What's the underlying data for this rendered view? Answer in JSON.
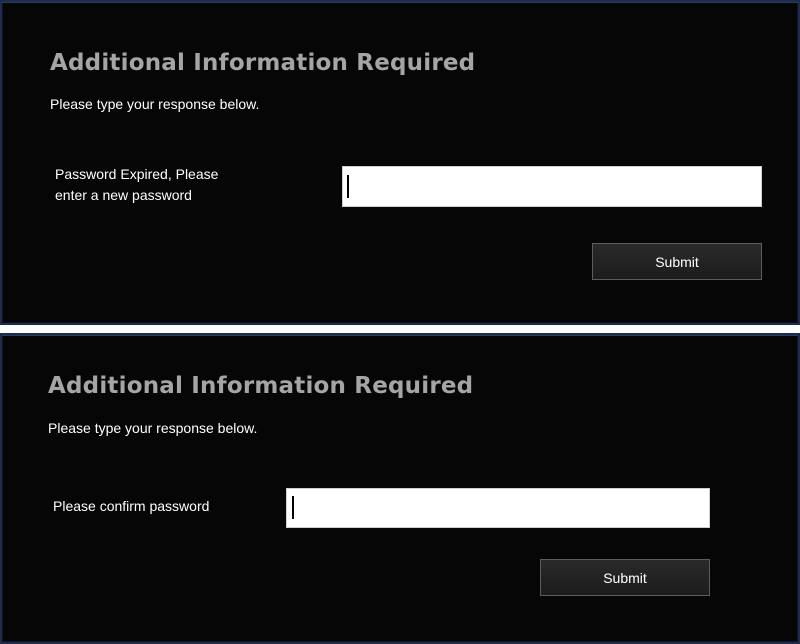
{
  "panels": [
    {
      "title": "Additional Information Required",
      "subtitle": "Please type your response below.",
      "field_label_line1": "Password Expired, Please",
      "field_label_line2": "enter a new password",
      "input_value": "",
      "submit_label": "Submit"
    },
    {
      "title": "Additional Information Required",
      "subtitle": "Please type your response below.",
      "field_label": "Please confirm password",
      "input_value": "",
      "submit_label": "Submit"
    }
  ],
  "colors": {
    "panel_background": "#060606",
    "panel_border": "#1c2c4a",
    "title_text": "#a5a5a5",
    "body_text": "#ffffff",
    "input_background": "#ffffff",
    "button_background": "#222222",
    "button_border": "#5c5c5c"
  }
}
